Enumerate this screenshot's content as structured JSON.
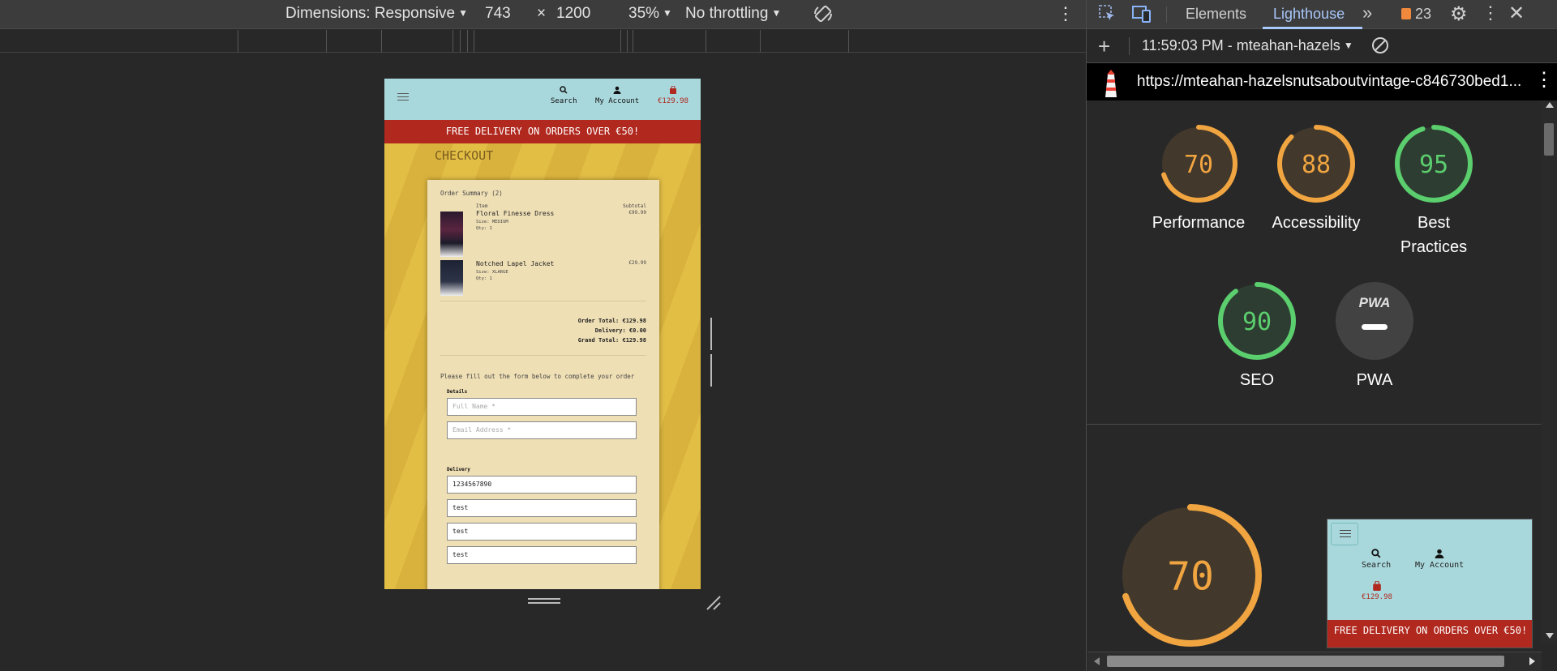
{
  "device_toolbar": {
    "dimensions_label": "Dimensions: Responsive",
    "width": "743",
    "times": "×",
    "height": "1200",
    "zoom": "35%",
    "throttling": "No throttling"
  },
  "site": {
    "nav": {
      "search_label": "Search",
      "account_label": "My Account",
      "cart_total": "€129.98"
    },
    "banner": "FREE DELIVERY ON ORDERS OVER €50!",
    "page_title": "CHECKOUT",
    "order_summary": {
      "heading": "Order Summary (2)",
      "col_item": "Item",
      "col_subtotal": "Subtotal",
      "items": [
        {
          "name": "Floral Finesse Dress",
          "size": "Size: MEDIUM",
          "qty": "Qty: 1",
          "subtotal": "€99.99"
        },
        {
          "name": "Notched Lapel Jacket",
          "size": "Size: XLARGE",
          "qty": "Qty: 1",
          "subtotal": "€29.99"
        }
      ],
      "order_total": "Order Total: €129.98",
      "delivery": "Delivery: €0.00",
      "grand_total": "Grand Total: €129.98"
    },
    "form": {
      "intro": "Please fill out the form below to complete your order",
      "details_label": "Details",
      "full_name_placeholder": "Full Name *",
      "email_placeholder": "Email Address *",
      "delivery_label": "Delivery",
      "phone_value": "1234567890",
      "field2_value": "test",
      "field3_value": "test",
      "field4_value": "test"
    }
  },
  "devtools": {
    "tabs": {
      "elements": "Elements",
      "lighthouse": "Lighthouse",
      "issues_count": "23"
    },
    "report_time": "11:59:03 PM - mteahan-hazels",
    "url": "https://mteahan-hazelsnutsaboutvintage-c846730bed1...",
    "scores": [
      {
        "label": "Performance",
        "value": "70",
        "score": 70,
        "color": "#f0a541"
      },
      {
        "label": "Accessibility",
        "value": "88",
        "score": 88,
        "color": "#f0a541"
      },
      {
        "label": "Best Practices",
        "value": "95",
        "score": 95,
        "color": "#5bce6e"
      },
      {
        "label": "SEO",
        "value": "90",
        "score": 90,
        "color": "#5bce6e"
      },
      {
        "label": "PWA",
        "value": "PWA"
      }
    ],
    "big_score": {
      "value": "70",
      "score": 70,
      "color": "#f0a541"
    },
    "preview": {
      "search_label": "Search",
      "account_label": "My Account",
      "cart_total": "€129.98",
      "banner": "FREE DELIVERY ON ORDERS OVER €50!"
    }
  }
}
